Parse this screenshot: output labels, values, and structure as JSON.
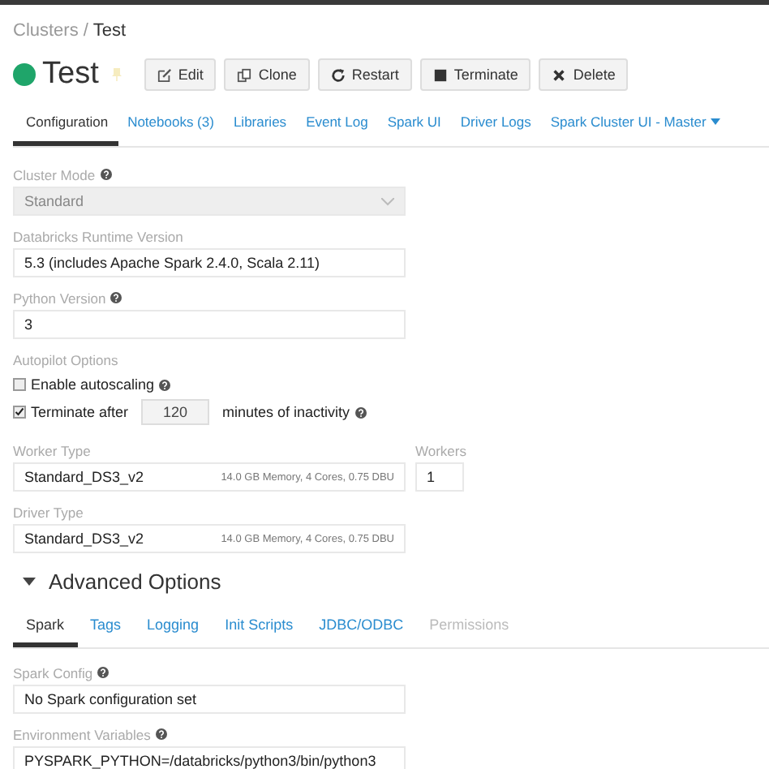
{
  "breadcrumb": {
    "parent": "Clusters",
    "separator": "/",
    "current": "Test"
  },
  "cluster": {
    "name": "Test",
    "color": "#1fa56a",
    "pinned": false
  },
  "actions": [
    {
      "kind": "edit",
      "label": "Edit"
    },
    {
      "kind": "clone",
      "label": "Clone"
    },
    {
      "kind": "restart",
      "label": "Restart"
    },
    {
      "kind": "terminate",
      "label": "Terminate"
    },
    {
      "kind": "delete",
      "label": "Delete"
    }
  ],
  "tabs": [
    {
      "label": "Configuration",
      "selected": true,
      "dropdown": false
    },
    {
      "label": "Notebooks (3)",
      "selected": false,
      "dropdown": false
    },
    {
      "label": "Libraries",
      "selected": false,
      "dropdown": false
    },
    {
      "label": "Event Log",
      "selected": false,
      "dropdown": false
    },
    {
      "label": "Spark UI",
      "selected": false,
      "dropdown": false
    },
    {
      "label": "Driver Logs",
      "selected": false,
      "dropdown": false
    },
    {
      "label": "Spark Cluster UI - Master",
      "selected": false,
      "dropdown": true
    }
  ],
  "cluster_mode": {
    "label": "Cluster Mode",
    "help": true,
    "value": "Standard",
    "disabled": true
  },
  "runtime_version": {
    "label": "Databricks Runtime Version",
    "value": "5.3 (includes Apache Spark 2.4.0, Scala 2.11)"
  },
  "python_version": {
    "label": "Python Version",
    "help": true,
    "value": "3"
  },
  "autopilot": {
    "label": "Autopilot Options",
    "autoscaling": {
      "label": "Enable autoscaling",
      "checked": false,
      "help": true
    },
    "terminate": {
      "label": "Terminate after",
      "checked": true,
      "value": "120",
      "suffix": "minutes of inactivity",
      "help": true
    }
  },
  "worker_type": {
    "label": "Worker Type",
    "value": "Standard_DS3_v2",
    "detail": "14.0 GB Memory, 4 Cores, 0.75 DBU"
  },
  "workers": {
    "label": "Workers",
    "value": "1"
  },
  "driver_type": {
    "label": "Driver Type",
    "value": "Standard_DS3_v2",
    "detail": "14.0 GB Memory, 4 Cores, 0.75 DBU"
  },
  "advanced": {
    "label": "Advanced Options",
    "expanded": true
  },
  "sub_tabs": [
    {
      "label": "Spark",
      "selected": true,
      "disabled": false
    },
    {
      "label": "Tags",
      "selected": false,
      "disabled": false
    },
    {
      "label": "Logging",
      "selected": false,
      "disabled": false
    },
    {
      "label": "Init Scripts",
      "selected": false,
      "disabled": false
    },
    {
      "label": "JDBC/ODBC",
      "selected": false,
      "disabled": false
    },
    {
      "label": "Permissions",
      "selected": false,
      "disabled": true
    }
  ],
  "spark_config": {
    "label": "Spark Config",
    "help": true,
    "value": "No Spark configuration set"
  },
  "env_vars": {
    "label": "Environment Variables",
    "help": true,
    "value": "PYSPARK_PYTHON=/databricks/python3/bin/python3"
  }
}
